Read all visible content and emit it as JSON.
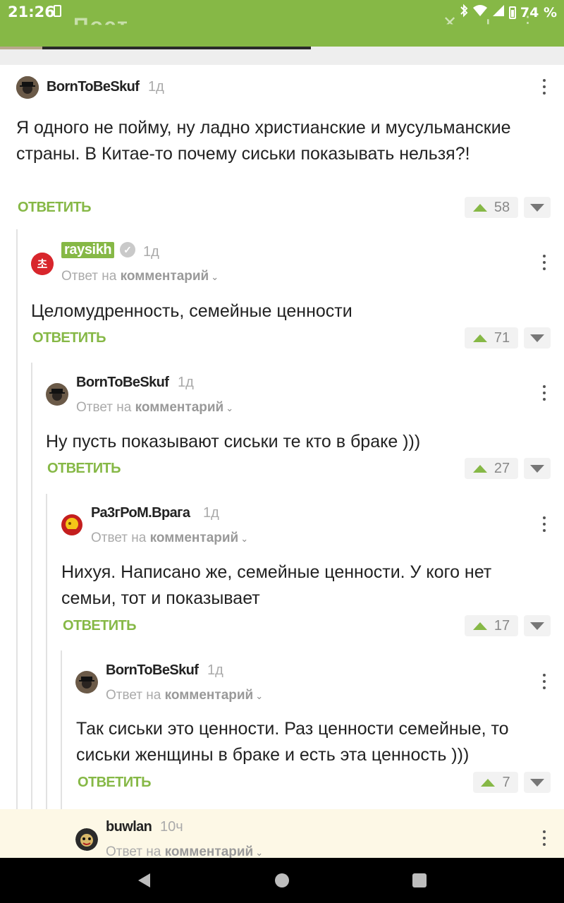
{
  "status_bar": {
    "time": "21:26",
    "battery": "74 %",
    "icons": [
      "sim-icon",
      "bluetooth-icon",
      "wifi-icon",
      "signal-icon",
      "battery-icon"
    ]
  },
  "app_bar": {
    "title_partial": "Пост",
    "icons": [
      "close-icon",
      "download-icon",
      "more-icon"
    ]
  },
  "colors": {
    "brand": "#86b846",
    "highlight": "#fdf8e6"
  },
  "comments": [
    {
      "username": "BornToBeSkuf",
      "time": "1д",
      "text": "Я одного не пойму, ну ладно христианские и мусульманские страны. В Китае-то почему сиськи показывать нельзя?!",
      "reply_label": "ОТВЕТИТЬ",
      "votes": "58"
    },
    {
      "username": "raysikh",
      "time": "1д",
      "reply_to_prefix": "Ответ на",
      "reply_to_link": "комментарий",
      "text": "Целомудренность, семейные ценности",
      "reply_label": "ОТВЕТИТЬ",
      "votes": "71"
    },
    {
      "username": "BornToBeSkuf",
      "time": "1д",
      "reply_to_prefix": "Ответ на",
      "reply_to_link": "комментарий",
      "text": "Ну пусть показывают сиськи те кто в браке )))",
      "reply_label": "ОТВЕТИТЬ",
      "votes": "27"
    },
    {
      "username": "Ра3гРоМ.Врага",
      "time": "1д",
      "reply_to_prefix": "Ответ на",
      "reply_to_link": "комментарий",
      "text": "Нихуя. Написано же, семейные ценности. У кого нет семьи, тот и показывает",
      "reply_label": "ОТВЕТИТЬ",
      "votes": "17"
    },
    {
      "username": "BornToBeSkuf",
      "time": "1д",
      "reply_to_prefix": "Ответ на",
      "reply_to_link": "комментарий",
      "text": "Так сиськи это ценности. Раз ценности семейные, то сиськи женщины в браке и есть эта ценность )))",
      "reply_label": "ОТВЕТИТЬ",
      "votes": "7"
    },
    {
      "username": "buwlan",
      "time": "10ч",
      "reply_to_prefix": "Ответ на",
      "reply_to_link": "комментарий"
    }
  ]
}
